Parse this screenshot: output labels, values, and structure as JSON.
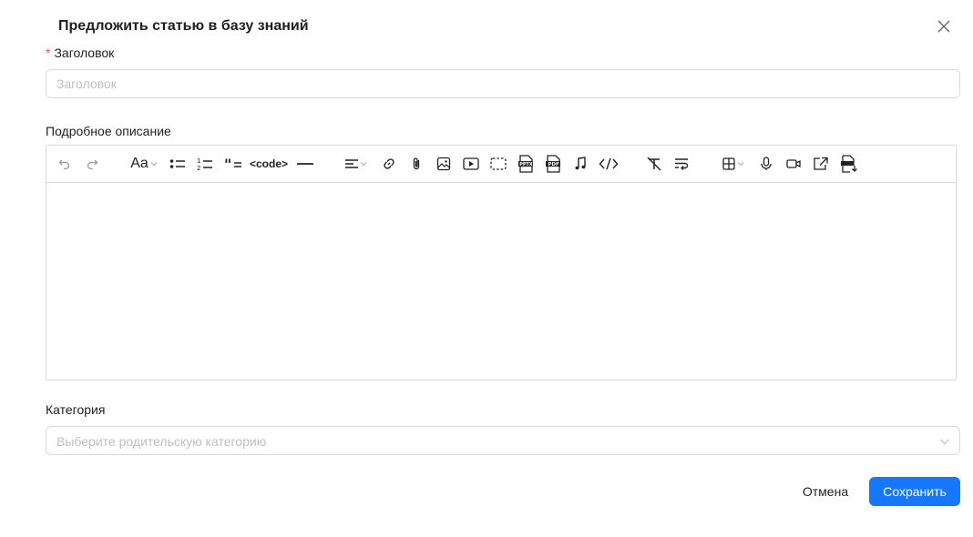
{
  "modal": {
    "title": "Предложить статью в базу знаний"
  },
  "title_field": {
    "required_mark": "*",
    "label": "Заголовок",
    "placeholder": "Заголовок",
    "value": ""
  },
  "description_field": {
    "label": "Подробное описание",
    "content": "",
    "toolbar": {
      "font_size_label": "Aa",
      "code_label": "<code>",
      "tools": [
        "undo-icon",
        "redo-icon",
        "font-size-icon",
        "bullet-list-icon",
        "numbered-list-icon",
        "blockquote-icon",
        "code-icon",
        "horizontal-rule-icon",
        "align-icon",
        "link-icon",
        "attachment-icon",
        "image-icon",
        "video-icon",
        "placeholder-block-icon",
        "pptx-icon",
        "pdf-icon",
        "audio-icon",
        "code-block-icon",
        "clear-format-icon",
        "wrap-icon",
        "table-icon",
        "microphone-icon",
        "camera-icon",
        "external-link-icon",
        "download-file-icon"
      ]
    }
  },
  "category_field": {
    "label": "Категория",
    "placeholder": "Выберите родительскую категорию",
    "value": ""
  },
  "actions": {
    "cancel_label": "Отмена",
    "save_label": "Сохранить"
  },
  "colors": {
    "primary": "#1677ff",
    "required": "#ff4d4f",
    "border": "#d9d9d9",
    "placeholder": "#bfbfbf"
  }
}
